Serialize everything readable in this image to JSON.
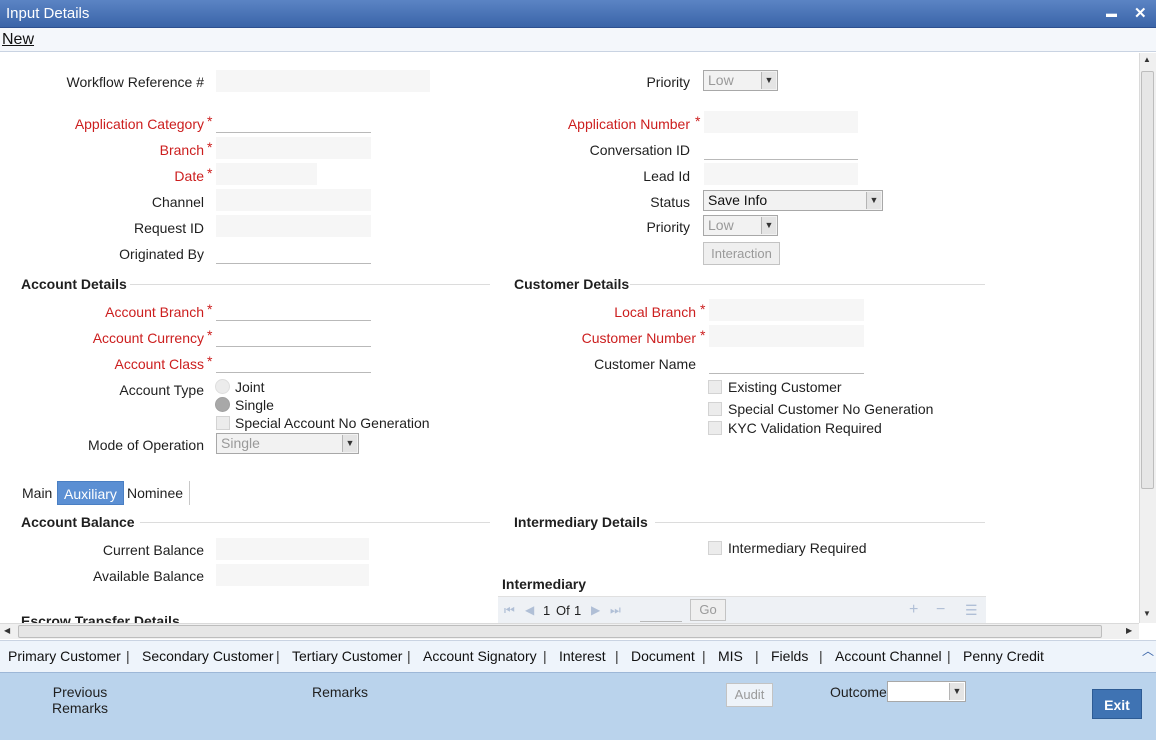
{
  "window": {
    "title": "Input Details",
    "minimize_glyph": "▬",
    "close_glyph": "✕"
  },
  "menu": {
    "new_label": "New"
  },
  "header": {
    "workflow_ref_label": "Workflow Reference #",
    "priority_label": "Priority",
    "priority_value": "Low",
    "application_category_label": "Application Category",
    "branch_label": "Branch",
    "date_label": "Date",
    "channel_label": "Channel",
    "request_id_label": "Request ID",
    "originated_by_label": "Originated By",
    "application_number_label": "Application Number",
    "conversation_id_label": "Conversation ID",
    "lead_id_label": "Lead Id",
    "status_label": "Status",
    "status_value": "Save Info",
    "priority2_label": "Priority",
    "priority2_value": "Low",
    "interaction_button": "Interaction",
    "star": "*"
  },
  "account_details": {
    "heading": "Account Details",
    "account_branch_label": "Account Branch",
    "account_currency_label": "Account Currency",
    "account_class_label": "Account Class",
    "account_type_label": "Account Type",
    "joint_label": "Joint",
    "single_label": "Single",
    "special_account_label": "Special Account No Generation",
    "mode_of_operation_label": "Mode of Operation",
    "mode_of_operation_value": "Single"
  },
  "customer_details": {
    "heading": "Customer Details",
    "local_branch_label": "Local Branch",
    "customer_number_label": "Customer Number",
    "customer_name_label": "Customer Name",
    "existing_customer_label": "Existing Customer",
    "special_customer_label": "Special Customer No Generation",
    "kyc_label": "KYC Validation Required"
  },
  "tabs": [
    {
      "label": "Main"
    },
    {
      "label": "Auxiliary",
      "active": true
    },
    {
      "label": "Nominee"
    }
  ],
  "account_balance": {
    "heading": "Account Balance",
    "current_balance_label": "Current Balance",
    "available_balance_label": "Available Balance"
  },
  "intermediary_details": {
    "heading": "Intermediary Details",
    "intermediary_required_label": "Intermediary Required"
  },
  "intermediary": {
    "heading": "Intermediary",
    "page_current": "1",
    "page_of": "Of",
    "page_total": "1",
    "go_button": "Go"
  },
  "escrow": {
    "heading": "Escrow Transfer Details"
  },
  "links": [
    "Primary Customer",
    "Secondary Customer",
    "Tertiary Customer",
    "Account Signatory",
    "Interest",
    "Document",
    "MIS",
    "Fields",
    "Account Channel",
    "Penny Credit"
  ],
  "footer": {
    "previous_remarks_line1": "Previous",
    "previous_remarks_line2": "Remarks",
    "remarks_label": "Remarks",
    "audit_button": "Audit",
    "outcome_label": "Outcome",
    "exit_button": "Exit"
  }
}
